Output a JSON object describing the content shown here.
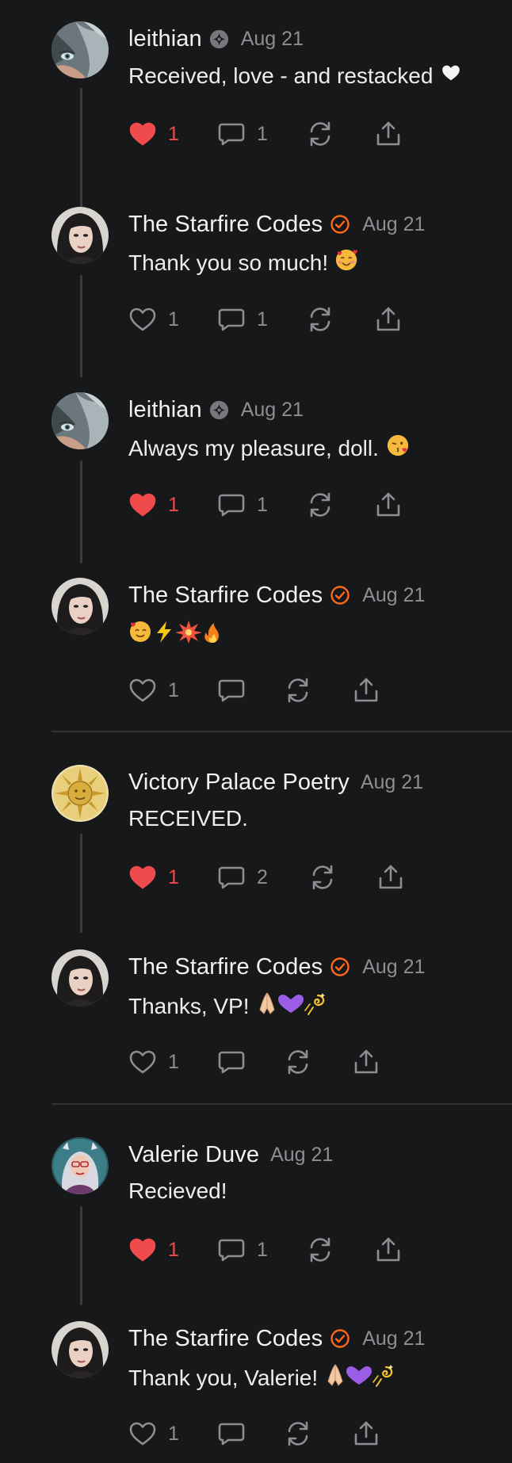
{
  "colors": {
    "background": "#17181a",
    "liked_red": "#ef4a4c",
    "muted": "#8d8e91",
    "verified_orange": "#ff6719"
  },
  "comments": [
    {
      "author": "leithian",
      "badge_icon": "sparkle-badge-icon",
      "date": "Aug 21",
      "text": "Received, love - and restacked",
      "trailing_emoji": "white-heart-emoji",
      "likes": "1",
      "liked": true,
      "replies": "1"
    },
    {
      "author": "The Starfire Codes",
      "badge_icon": "verified-check-icon",
      "date": "Aug 21",
      "text": "Thank you so much!",
      "trailing_emoji": "smiling-face-with-hearts-emoji",
      "likes": "1",
      "liked": false,
      "replies": "1"
    },
    {
      "author": "leithian",
      "badge_icon": "sparkle-badge-icon",
      "date": "Aug 21",
      "text": "Always my pleasure, doll.",
      "trailing_emoji": "face-blowing-kiss-emoji",
      "likes": "1",
      "liked": true,
      "replies": "1"
    },
    {
      "author": "The Starfire Codes",
      "badge_icon": "verified-check-icon",
      "date": "Aug 21",
      "text": "",
      "trailing_emoji": "emoji-row-hearts-lightning-burst-fire",
      "likes": "1",
      "liked": false,
      "replies": ""
    },
    {
      "author": "Victory Palace Poetry",
      "date": "Aug 21",
      "text": "RECEIVED.",
      "likes": "1",
      "liked": true,
      "replies": "2"
    },
    {
      "author": "The Starfire Codes",
      "badge_icon": "verified-check-icon",
      "date": "Aug 21",
      "text": "Thanks, VP!",
      "trailing_emoji": "folded-hands-purple-heart-dizzy-emoji",
      "likes": "1",
      "liked": false,
      "replies": ""
    },
    {
      "author": "Valerie Duve",
      "date": "Aug 21",
      "text": "Recieved!",
      "likes": "1",
      "liked": true,
      "replies": "1"
    },
    {
      "author": "The Starfire Codes",
      "badge_icon": "verified-check-icon",
      "date": "Aug 21",
      "text": "Thank you, Valerie!",
      "trailing_emoji": "folded-hands-purple-heart-dizzy-emoji",
      "likes": "1",
      "liked": false,
      "replies": ""
    }
  ]
}
